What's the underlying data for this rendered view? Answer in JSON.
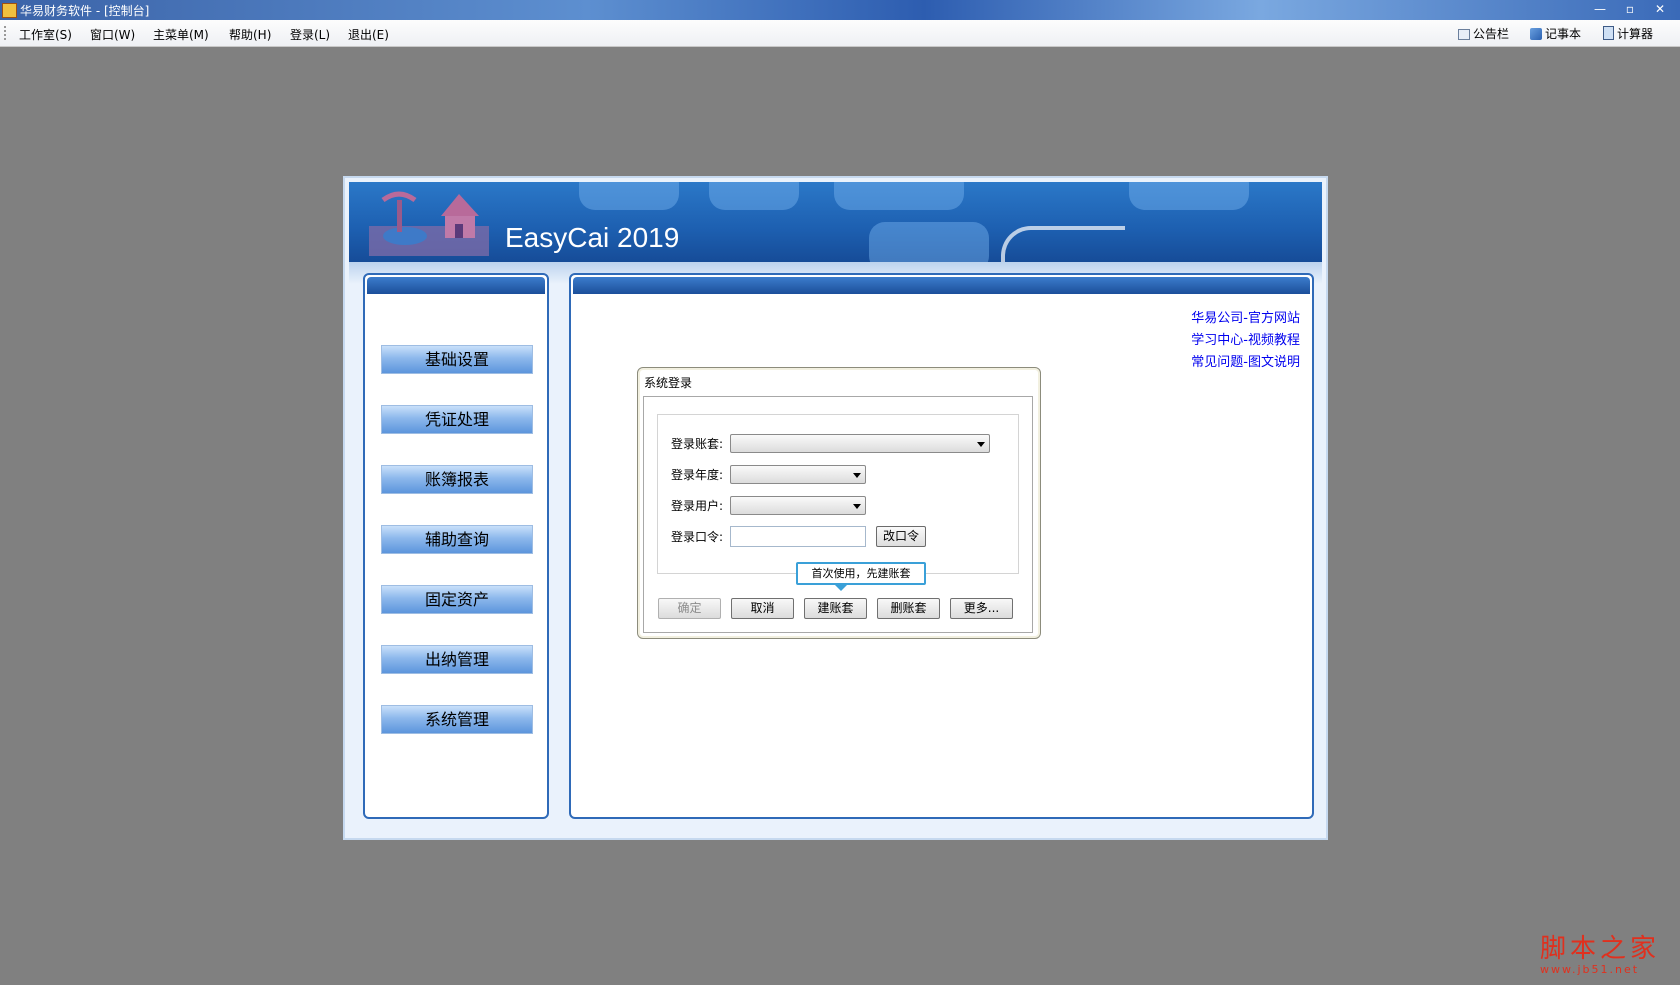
{
  "window": {
    "title": "华易财务软件 - [控制台]",
    "controls": [
      "—",
      "▫",
      "✕"
    ]
  },
  "menu": {
    "items": [
      "工作室(S)",
      "窗口(W)",
      "主菜单(M)",
      "帮助(H)",
      "登录(L)",
      "退出(E)"
    ],
    "tools": [
      "公告栏",
      "记事本",
      "计算器"
    ]
  },
  "banner": {
    "brand": "EasyCai 2019"
  },
  "nav": {
    "buttons": [
      "基础设置",
      "凭证处理",
      "账簿报表",
      "辅助查询",
      "固定资产",
      "出纳管理",
      "系统管理"
    ]
  },
  "links": [
    "华易公司-官方网站",
    "学习中心-视频教程",
    "常见问题-图文说明"
  ],
  "login": {
    "title": "系统登录",
    "labels": {
      "account_set": "登录账套:",
      "year": "登录年度:",
      "user": "登录用户:",
      "password": "登录口令:"
    },
    "values": {
      "account_set": "",
      "year": "",
      "user": "",
      "password": ""
    },
    "change_password": "改口令",
    "tooltip": "首次使用，先建账套",
    "buttons": {
      "ok": "确定",
      "cancel": "取消",
      "create": "建账套",
      "delete": "删账套",
      "more": "更多..."
    }
  },
  "watermark": {
    "cn": "脚本之家",
    "url": "www.jb51.net"
  },
  "colors": {
    "desktop": "#808080",
    "panel_border": "#2f6ab8",
    "nav_button": "#8db8ec",
    "link": "#0000ee",
    "tooltip_border": "#3aa0d8",
    "watermark": "#e0301e"
  }
}
